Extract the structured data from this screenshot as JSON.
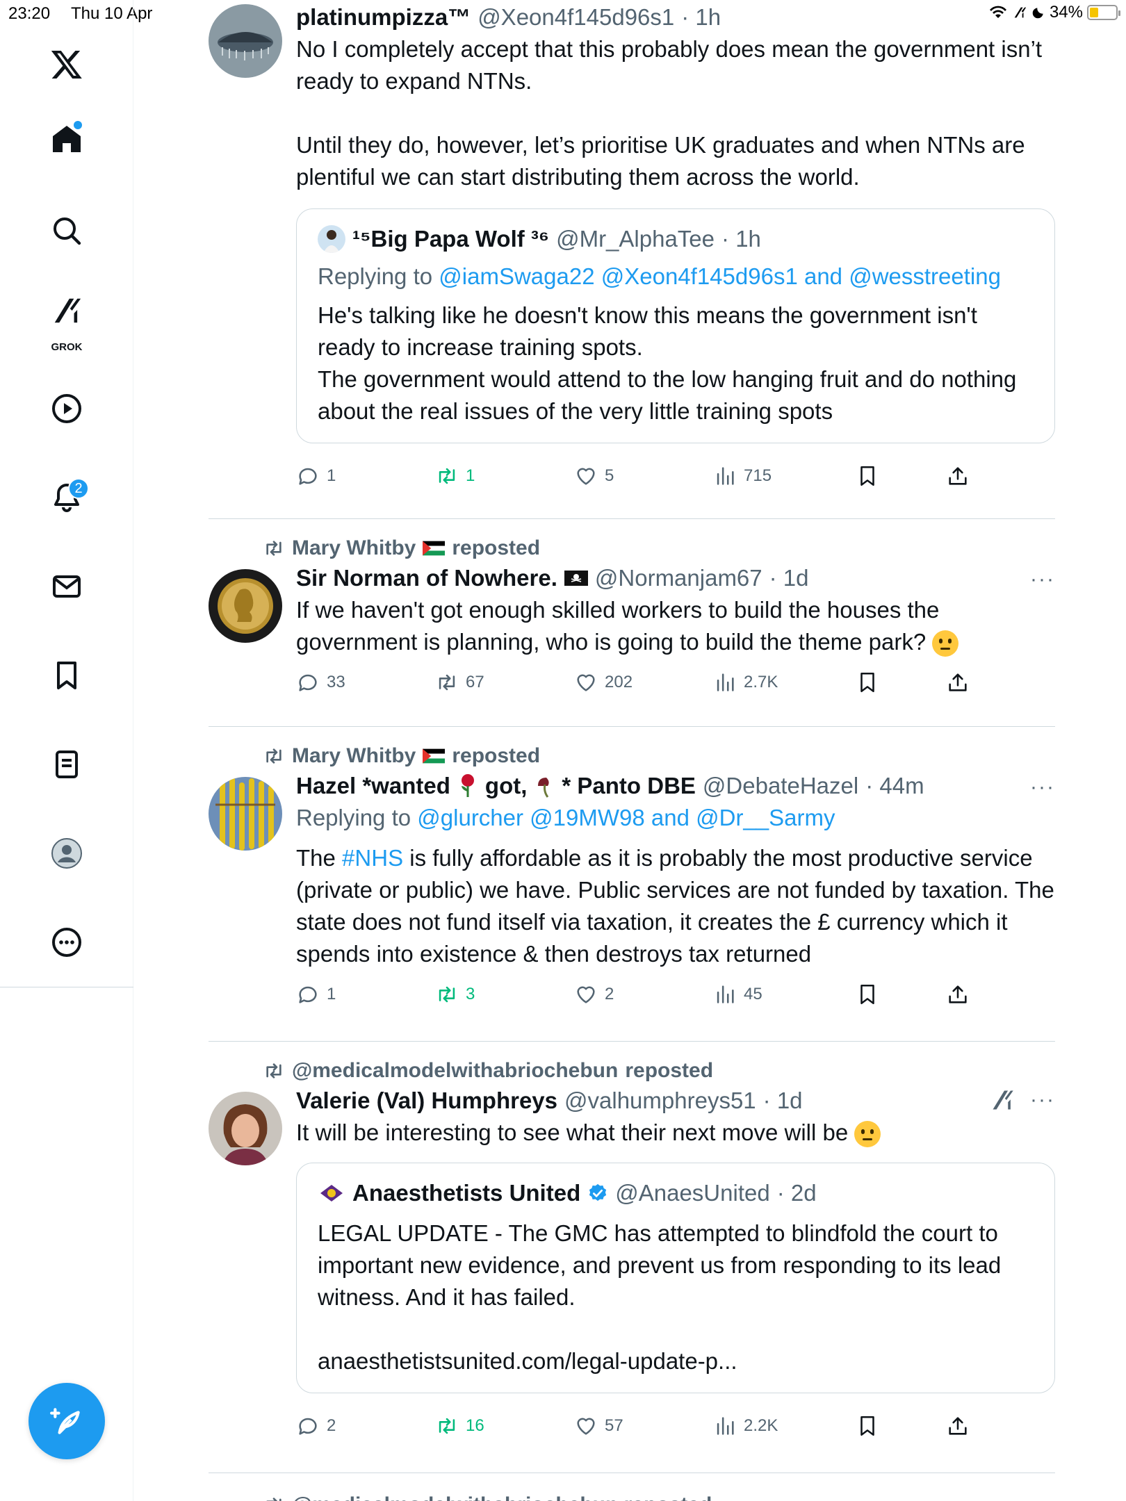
{
  "status_bar": {
    "time": "23:20",
    "date": "Thu 10 Apr",
    "battery": "34%"
  },
  "sidebar": {
    "items": [
      {
        "name": "x-logo"
      },
      {
        "name": "home"
      },
      {
        "name": "search"
      },
      {
        "name": "grok",
        "label": "GROK"
      },
      {
        "name": "video"
      },
      {
        "name": "notifications",
        "badge": "2"
      },
      {
        "name": "messages"
      },
      {
        "name": "bookmarks"
      },
      {
        "name": "lists"
      },
      {
        "name": "profile"
      },
      {
        "name": "more"
      }
    ]
  },
  "posts": [
    {
      "name": "platinumpizza™",
      "handle": "@Xeon4f145d96s1",
      "time": "· 1h",
      "text1": "No I completely accept that this probably does mean the government isn’t ready to expand NTNs.",
      "text2": "Until they do, however, let’s prioritise UK graduates and when NTNs are plentiful we can start distributing them across the world.",
      "quote": {
        "name": "¹⁵Big Papa Wolf ³⁶",
        "handle": "@Mr_AlphaTee",
        "time": "· 1h",
        "reply_prefix": "Replying to",
        "reply_to": "@iamSwaga22 @Xeon4f145d96s1 and @wesstreeting",
        "text": "He's talking like he doesn't know this means the government isn't ready to increase training spots.\nThe government would attend to the low hanging fruit and do nothing about the real issues of the very little training spots"
      },
      "stats": {
        "replies": "1",
        "reposts": "1",
        "likes": "5",
        "views": "715"
      }
    },
    {
      "reposted_by": "Mary Whitby",
      "reposted_label": "reposted",
      "name": "Sir Norman of Nowhere.",
      "handle": "@Normanjam67",
      "time": "· 1d",
      "more": "···",
      "text": "If we haven't got enough skilled workers to build the houses the government is planning, who is going to build the theme park?",
      "stats": {
        "replies": "33",
        "reposts": "67",
        "likes": "202",
        "views": "2.7K"
      }
    },
    {
      "reposted_by": "Mary Whitby",
      "reposted_label": "reposted",
      "name_part1": "Hazel *wanted",
      "name_part2": "got,",
      "name_part3": "* Panto DBE",
      "handle": "@DebateHazel",
      "time": "· 44m",
      "more": "···",
      "reply_prefix": "Replying to",
      "reply_to": "@glurcher @19MW98 and @Dr__Sarmy",
      "text_pre": "The ",
      "hashtag": "#NHS",
      "text_post": " is fully affordable as it is probably the most productive service (private or public) we have. Public services are not funded by taxation. The state does not fund itself via taxation, it creates the £ currency which it spends into existence & then destroys tax returned",
      "stats": {
        "replies": "1",
        "reposts": "3",
        "likes": "2",
        "views": "45"
      }
    },
    {
      "reposted_by": "@medicalmodelwithabriochebun",
      "reposted_label": "reposted",
      "name": "Valerie (Val) Humphreys",
      "handle": "@valhumphreys51",
      "time": "· 1d",
      "more": "···",
      "text": "It will be interesting to see what their next move will be",
      "quote": {
        "name": "Anaesthetists United",
        "handle": "@AnaesUnited",
        "time": "· 2d",
        "text": "LEGAL UPDATE - The GMC has attempted to blindfold the court to important new evidence, and prevent us from responding to its lead witness. And it has failed.",
        "link": "anaesthetistsunited.com/legal-update-p..."
      },
      "stats": {
        "replies": "2",
        "reposts": "16",
        "likes": "57",
        "views": "2.2K"
      }
    }
  ],
  "next_repost_partial": "@medicalmodelwithabriochebun reposted",
  "colors": {
    "accent": "#1d9bf0",
    "repost_green": "#00ba7c",
    "secondary_text": "#536471"
  }
}
